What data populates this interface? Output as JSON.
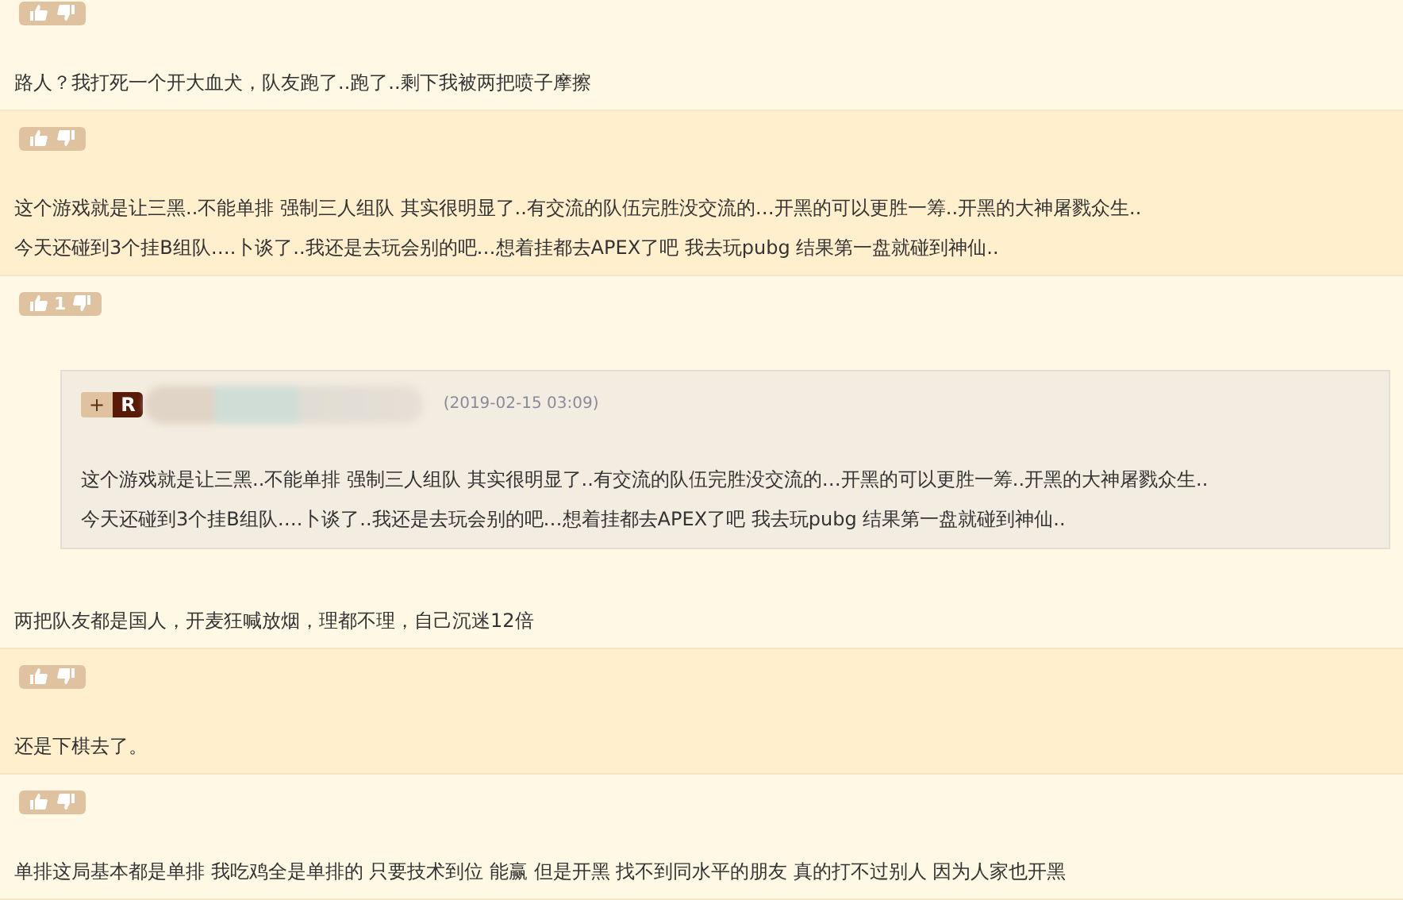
{
  "comments": [
    {
      "highlighted": false,
      "lines": [
        "路人？我打死一个开大血犬，队友跑了..跑了..剩下我被两把喷子摩擦"
      ]
    },
    {
      "highlighted": true,
      "lines": [
        "这个游戏就是让三黑..不能单排 强制三人组队 其实很明显了..有交流的队伍完胜没交流的…开黑的可以更胜一筹..开黑的大神屠戮众生..",
        "今天还碰到3个挂B组队….卜谈了..我还是去玩会别的吧…想着挂都去APEX了吧 我去玩pubg 结果第一盘就碰到神仙.."
      ]
    },
    {
      "highlighted": false,
      "likes": "1",
      "reply": {
        "plus": "+",
        "letter": "R",
        "time": "(2019-02-15 03:09)",
        "lines": [
          "这个游戏就是让三黑..不能单排 强制三人组队 其实很明显了..有交流的队伍完胜没交流的…开黑的可以更胜一筹..开黑的大神屠戮众生..",
          "今天还碰到3个挂B组队….卜谈了..我还是去玩会别的吧…想着挂都去APEX了吧 我去玩pubg 结果第一盘就碰到神仙.."
        ]
      },
      "lines": [
        "两把队友都是国人，开麦狂喊放烟，理都不理，自己沉迷12倍"
      ]
    },
    {
      "highlighted": true,
      "lines": [
        "还是下棋去了。"
      ]
    },
    {
      "highlighted": false,
      "lines": [
        "单排这局基本都是单排 我吃鸡全是单排的 只要技术到位 能赢 但是开黑 找不到同水平的朋友 真的打不过别人 因为人家也开黑"
      ]
    }
  ]
}
